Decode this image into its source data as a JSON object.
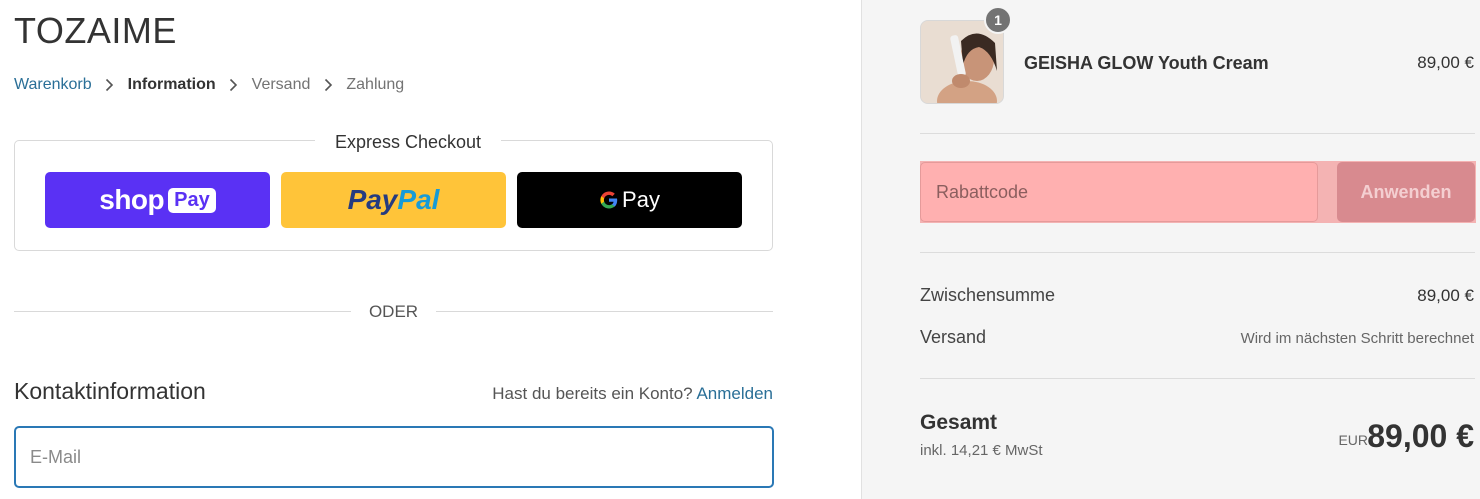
{
  "brand": "TOZAIME",
  "breadcrumb": {
    "items": [
      "Warenkorb",
      "Information",
      "Versand",
      "Zahlung"
    ]
  },
  "express": {
    "title": "Express Checkout",
    "shop_word": "shop",
    "shop_pay": "Pay",
    "paypal_1": "Pay",
    "paypal_2": "Pal",
    "gpay_g": "G",
    "gpay_pay": "Pay",
    "colors": {
      "shop": "#5a31f4",
      "paypal": "#ffc439",
      "gpay": "#000000"
    }
  },
  "divider_text": "ODER",
  "contact": {
    "title": "Kontaktinformation",
    "account_question": "Hast du bereits ein Konto?",
    "login": "Anmelden",
    "email_placeholder": "E-Mail"
  },
  "summary": {
    "product": {
      "name": "GEISHA GLOW Youth Cream",
      "price": "89,00 €",
      "quantity": "1"
    },
    "discount": {
      "placeholder": "Rabattcode",
      "button": "Anwenden"
    },
    "subtotal_label": "Zwischensumme",
    "subtotal_value": "89,00 €",
    "shipping_label": "Versand",
    "shipping_value": "Wird im nächsten Schritt berechnet",
    "total_label": "Gesamt",
    "tax_note": "inkl. 14,21 € MwSt",
    "currency": "EUR",
    "total_value": "89,00 €"
  }
}
